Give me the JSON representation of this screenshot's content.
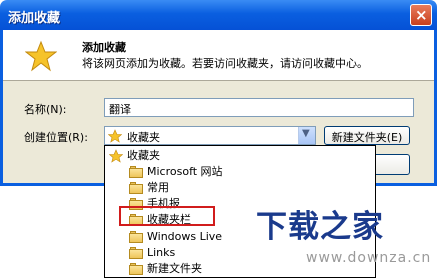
{
  "window": {
    "title": "添加收藏",
    "close_label": "×"
  },
  "header": {
    "title": "添加收藏",
    "description": "将该网页添加为收藏。若要访问收藏夹，请访问收藏中心。"
  },
  "form": {
    "name_label": "名称(N):",
    "name_value": "翻译",
    "location_label": "创建位置(R):",
    "location_value": "收藏夹",
    "new_folder_button": "新建文件夹(E)"
  },
  "dropdown": {
    "items": [
      {
        "label": "收藏夹",
        "icon": "star-icon"
      },
      {
        "label": "Microsoft 网站",
        "icon": "folder-icon"
      },
      {
        "label": "常用",
        "icon": "folder-icon"
      },
      {
        "label": "手机报",
        "icon": "folder-icon"
      },
      {
        "label": "收藏夹栏",
        "icon": "folder-icon"
      },
      {
        "label": "Windows Live",
        "icon": "folder-icon"
      },
      {
        "label": "Links",
        "icon": "folder-icon"
      },
      {
        "label": "新建文件夹",
        "icon": "folder-icon"
      }
    ]
  },
  "watermark": {
    "title": "下载之家",
    "url": "www.downza.cn"
  },
  "colors": {
    "titlebar": "#0a5fe0",
    "highlight_border": "#d11c1c",
    "dialog_bg": "#ece9d8"
  }
}
